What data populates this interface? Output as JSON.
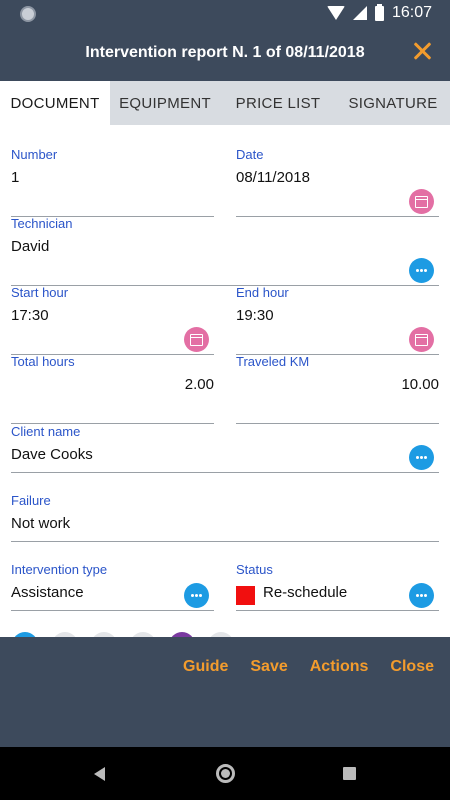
{
  "status_bar": {
    "time": "16:07"
  },
  "header": {
    "title": "Intervention report N. 1 of 08/11/2018"
  },
  "tabs": [
    {
      "label": "DOCUMENT",
      "active": true
    },
    {
      "label": "EQUIPMENT",
      "active": false
    },
    {
      "label": "PRICE LIST",
      "active": false
    },
    {
      "label": "SIGNATURE",
      "active": false
    }
  ],
  "form": {
    "number": {
      "label": "Number",
      "value": "1"
    },
    "date": {
      "label": "Date",
      "value": "08/11/2018"
    },
    "technician": {
      "label": "Technician",
      "value": "David"
    },
    "start_hour": {
      "label": "Start hour",
      "value": "17:30"
    },
    "end_hour": {
      "label": "End hour",
      "value": "19:30"
    },
    "total_hours": {
      "label": "Total hours",
      "value": "2.00"
    },
    "traveled_km": {
      "label": "Traveled KM",
      "value": "10.00"
    },
    "client_name": {
      "label": "Client name",
      "value": "Dave Cooks"
    },
    "failure": {
      "label": "Failure",
      "value": "Not work"
    },
    "intervention_type": {
      "label": "Intervention type",
      "value": "Assistance"
    },
    "status": {
      "label": "Status",
      "value": "Re-schedule",
      "color": "#f10f0f"
    }
  },
  "actions": {
    "guide": "Guide",
    "save": "Save",
    "actions": "Actions",
    "close": "Close"
  },
  "colors": {
    "header_bg": "#3d4a5c",
    "accent": "#f39c2d",
    "label_blue": "#2b55c9",
    "dots_button": "#1d9be3",
    "calendar_button": "#e36fa4"
  },
  "icons": [
    "close-icon",
    "more-icon",
    "calendar-icon",
    "wifi-icon",
    "signal-icon",
    "battery-icon",
    "back-icon",
    "home-icon",
    "recents-icon"
  ]
}
